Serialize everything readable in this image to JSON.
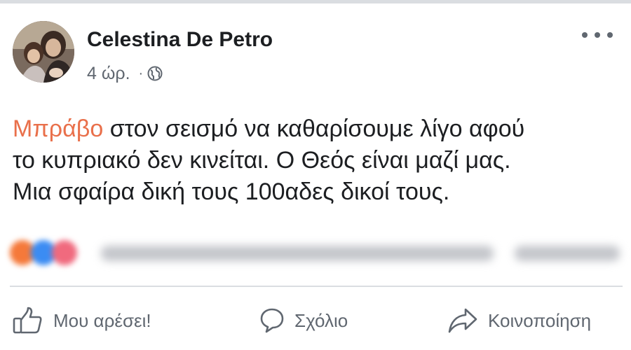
{
  "post": {
    "author": "Celestina De Petro",
    "time": "4 ώρ.",
    "meta_separator": "·",
    "privacy_icon": "globe-icon",
    "more_icon": "more-options-icon",
    "text": {
      "mention": "Μπράβο",
      "lines": [
        " στον σεισμό να καθαρίσουμε λίγο αφού",
        "το κυπριακό δεν κινείται. Ο Θεός είναι μαζί μας.",
        "Μια σφαίρα δική τους 100αδες δικοί τους."
      ]
    },
    "reactions": {
      "icons": [
        "angry-reaction-icon",
        "like-reaction-icon",
        "love-reaction-icon"
      ],
      "colors": [
        "#f5793a",
        "#3b8cf3",
        "#f06a7e"
      ]
    }
  },
  "actions": {
    "like": {
      "label": "Μου αρέσει!",
      "icon": "thumbs-up-icon"
    },
    "comment": {
      "label": "Σχόλιο",
      "icon": "comment-icon"
    },
    "share": {
      "label": "Κοινοποίηση",
      "icon": "share-icon"
    }
  },
  "colors": {
    "mention": "#e9704b",
    "text": "#1c1e21",
    "secondary": "#606770",
    "divider": "#dadde1"
  }
}
